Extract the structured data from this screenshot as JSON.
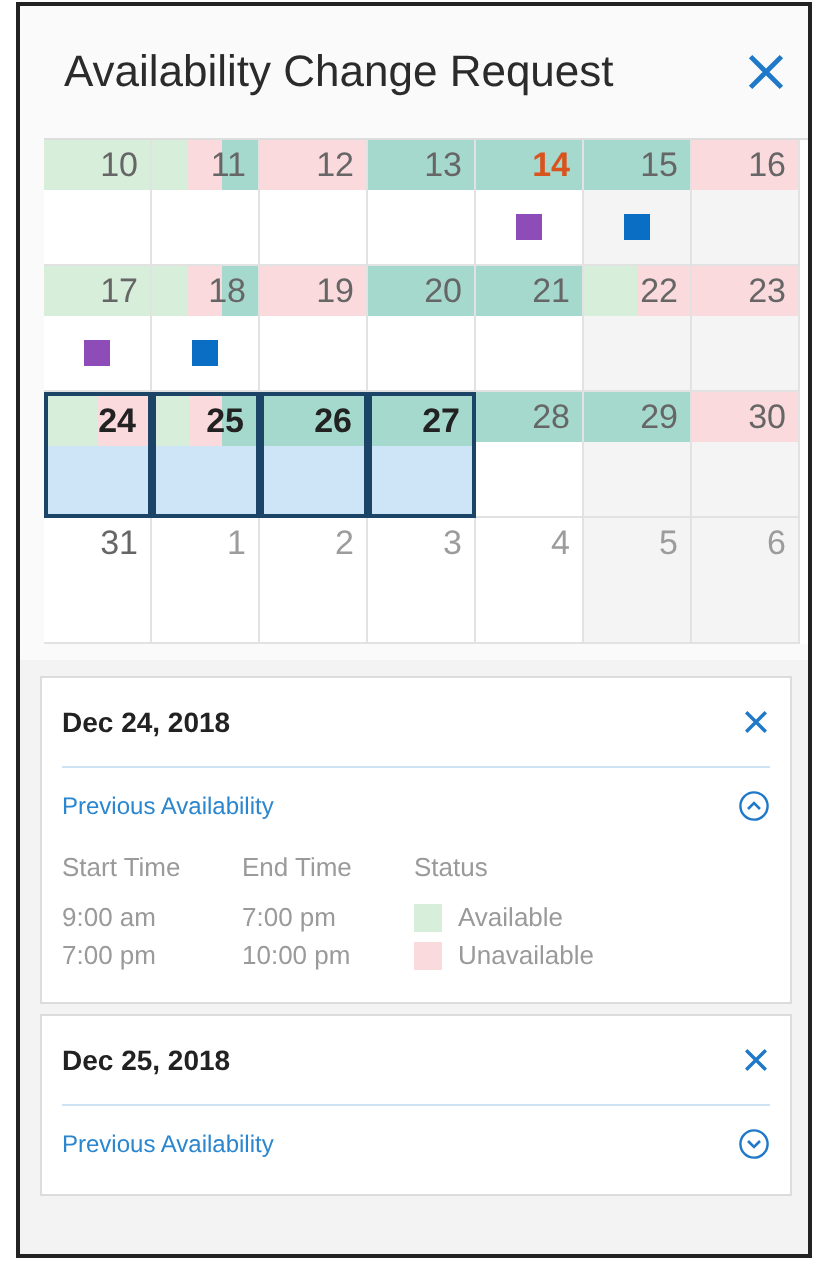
{
  "window": {
    "title": "Availability Change Request"
  },
  "calendar": {
    "weeks": [
      {
        "days": [
          {
            "number": "10",
            "segments": [
              {
                "color": "#d7eedb"
              }
            ]
          },
          {
            "number": "11",
            "segments": [
              {
                "color": "#d7eedb"
              },
              {
                "color": "#fadadd"
              },
              {
                "color": "#a6d9cd"
              }
            ]
          },
          {
            "number": "12",
            "segments": [
              {
                "color": "#fadadd"
              }
            ]
          },
          {
            "number": "13",
            "segments": [
              {
                "color": "#a6d9cd"
              }
            ]
          },
          {
            "number": "14",
            "today": true,
            "segments": [
              {
                "color": "#a6d9cd"
              }
            ],
            "marker": {
              "color": "#8e4cb8"
            }
          },
          {
            "number": "15",
            "segments": [
              {
                "color": "#a6d9cd"
              }
            ],
            "marker": {
              "color": "#0a6ec4"
            }
          },
          {
            "number": "16",
            "segments": [
              {
                "color": "#fadadd"
              }
            ]
          }
        ]
      },
      {
        "days": [
          {
            "number": "17",
            "segments": [
              {
                "color": "#d7eedb"
              }
            ],
            "marker": {
              "color": "#8e4cb8"
            }
          },
          {
            "number": "18",
            "segments": [
              {
                "color": "#d7eedb"
              },
              {
                "color": "#fadadd"
              },
              {
                "color": "#a6d9cd"
              }
            ],
            "marker": {
              "color": "#0a6ec4"
            }
          },
          {
            "number": "19",
            "segments": [
              {
                "color": "#fadadd"
              }
            ]
          },
          {
            "number": "20",
            "segments": [
              {
                "color": "#a6d9cd"
              }
            ]
          },
          {
            "number": "21",
            "segments": [
              {
                "color": "#a6d9cd"
              }
            ]
          },
          {
            "number": "22",
            "segments": [
              {
                "color": "#d7eedb"
              },
              {
                "color": "#fadadd"
              }
            ]
          },
          {
            "number": "23",
            "segments": [
              {
                "color": "#fadadd"
              }
            ]
          }
        ]
      },
      {
        "days": [
          {
            "number": "24",
            "selected": true,
            "segments": [
              {
                "color": "#d7eedb"
              },
              {
                "color": "#fadadd"
              }
            ]
          },
          {
            "number": "25",
            "selected": true,
            "segments": [
              {
                "color": "#d7eedb"
              },
              {
                "color": "#fadadd"
              },
              {
                "color": "#a6d9cd"
              }
            ]
          },
          {
            "number": "26",
            "selected": true,
            "segments": [
              {
                "color": "#a6d9cd"
              }
            ]
          },
          {
            "number": "27",
            "selected": true,
            "segments": [
              {
                "color": "#a6d9cd"
              }
            ]
          },
          {
            "number": "28",
            "selected": false,
            "segments": [
              {
                "color": "#a6d9cd"
              }
            ]
          },
          {
            "number": "29",
            "selected": false,
            "segments": [
              {
                "color": "#a6d9cd"
              }
            ]
          },
          {
            "number": "30",
            "selected": false,
            "segments": [
              {
                "color": "#fadadd"
              }
            ]
          }
        ]
      },
      {
        "days": [
          {
            "number": "31"
          },
          {
            "number": "1",
            "outside": true
          },
          {
            "number": "2",
            "outside": true
          },
          {
            "number": "3",
            "outside": true
          },
          {
            "number": "4",
            "outside": true
          },
          {
            "number": "5",
            "outside": true
          },
          {
            "number": "6",
            "outside": true
          }
        ]
      }
    ]
  },
  "requests": [
    {
      "date": "Dec 24, 2018",
      "link": "Previous Availability",
      "expanded": true,
      "columns": [
        "Start Time",
        "End Time",
        "Status"
      ],
      "rows": [
        {
          "start": "9:00 am",
          "end": "7:00 pm",
          "status": "Available",
          "color": "#d7eedb"
        },
        {
          "start": "7:00 pm",
          "end": "10:00 pm",
          "status": "Unavailable",
          "color": "#fadadd"
        }
      ]
    },
    {
      "date": "Dec 25, 2018",
      "link": "Previous Availability",
      "expanded": false
    }
  ]
}
